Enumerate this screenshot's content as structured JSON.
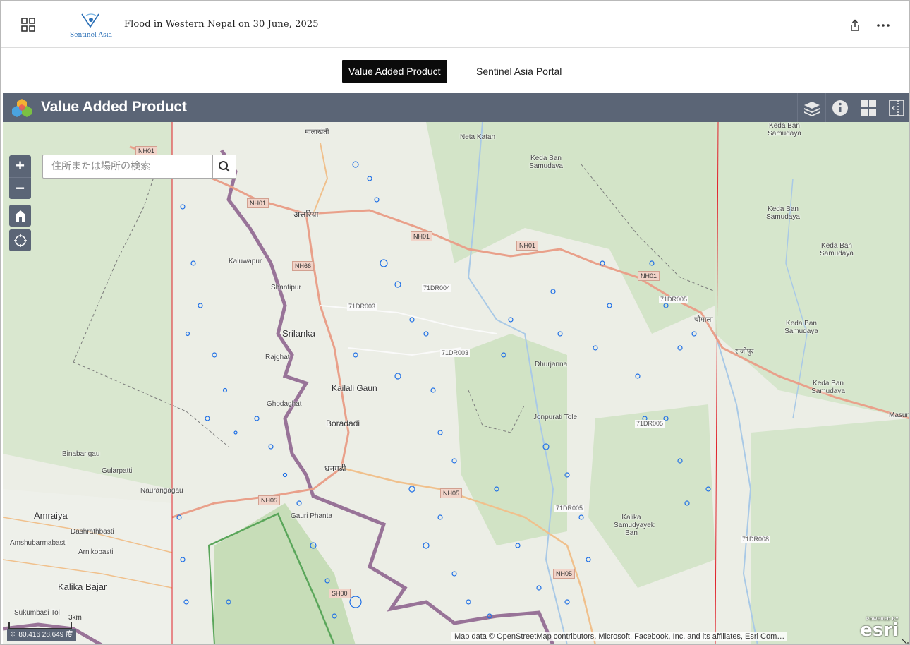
{
  "header": {
    "title": "Flood in Western Nepal on 30 June, 2025",
    "logo_text": "Sentinel Asia",
    "icons": {
      "apps": "apps-grid-icon",
      "share": "share-icon",
      "more": "more-dots-icon"
    }
  },
  "tabs": [
    {
      "label": "Value Added Product",
      "active": true
    },
    {
      "label": "Sentinel Asia Portal",
      "active": false
    }
  ],
  "map_app": {
    "title": "Value Added Product",
    "toolbar": [
      "layers-icon",
      "info-icon",
      "basemap-gallery-icon",
      "split-panel-icon"
    ],
    "search": {
      "placeholder": "住所または場所の検索",
      "value": ""
    },
    "zoom_in": "+",
    "zoom_out": "−",
    "coordinates": "80.416 28.649 度",
    "scale_label": "3km",
    "attribution": "Map data © OpenStreetMap contributors, Microsoft, Facebook, Inc. and its affiliates, Esri Com…",
    "esri": {
      "powered": "POWERED BY",
      "word": "esri"
    },
    "colors": {
      "bar": "#5b6576",
      "flood": "#1e6fe6",
      "boundary": "#8a5d8a",
      "grid_line": "#e0232b",
      "forest": "#cfe2c5"
    }
  },
  "map_labels": {
    "places": [
      "मालाखेती",
      "Neta Katan",
      "Keda Ban Samudaya",
      "Keda Ban Samudaya",
      "Keda Ban Samudaya",
      "Keda Ban Samudaya",
      "Keda Ban Samudaya",
      "Keda Ban Samudaya",
      "अत्तरिया",
      "Kaluwapur",
      "Shantipur",
      "Srilanka",
      "Rajghat",
      "Kailali Gaun",
      "Ghodaghat",
      "Boradadi",
      "धनगढी",
      "Dhurjanna",
      "Jonpurati Tole",
      "चौमाला",
      "राजीपुर",
      "Masur",
      "Binabarigau",
      "Gularpatti",
      "Naurangagau",
      "Amraiya",
      "Dashrathbasti",
      "Amshubarmabasti",
      "Arnikobasti",
      "Kalika Bajar",
      "Sukumbasi Tol",
      "Gauri Phanta",
      "Kalika Samudyayek Ban"
    ],
    "roads": [
      "NH01",
      "NH01",
      "NH01",
      "NH01",
      "NH01",
      "NH66",
      "NH05",
      "NH05",
      "NH05",
      "SH00"
    ],
    "road_codes": [
      "71DR004",
      "71DR003",
      "71DR003",
      "71DR005",
      "71DR005",
      "71DR005",
      "71DR008"
    ]
  }
}
